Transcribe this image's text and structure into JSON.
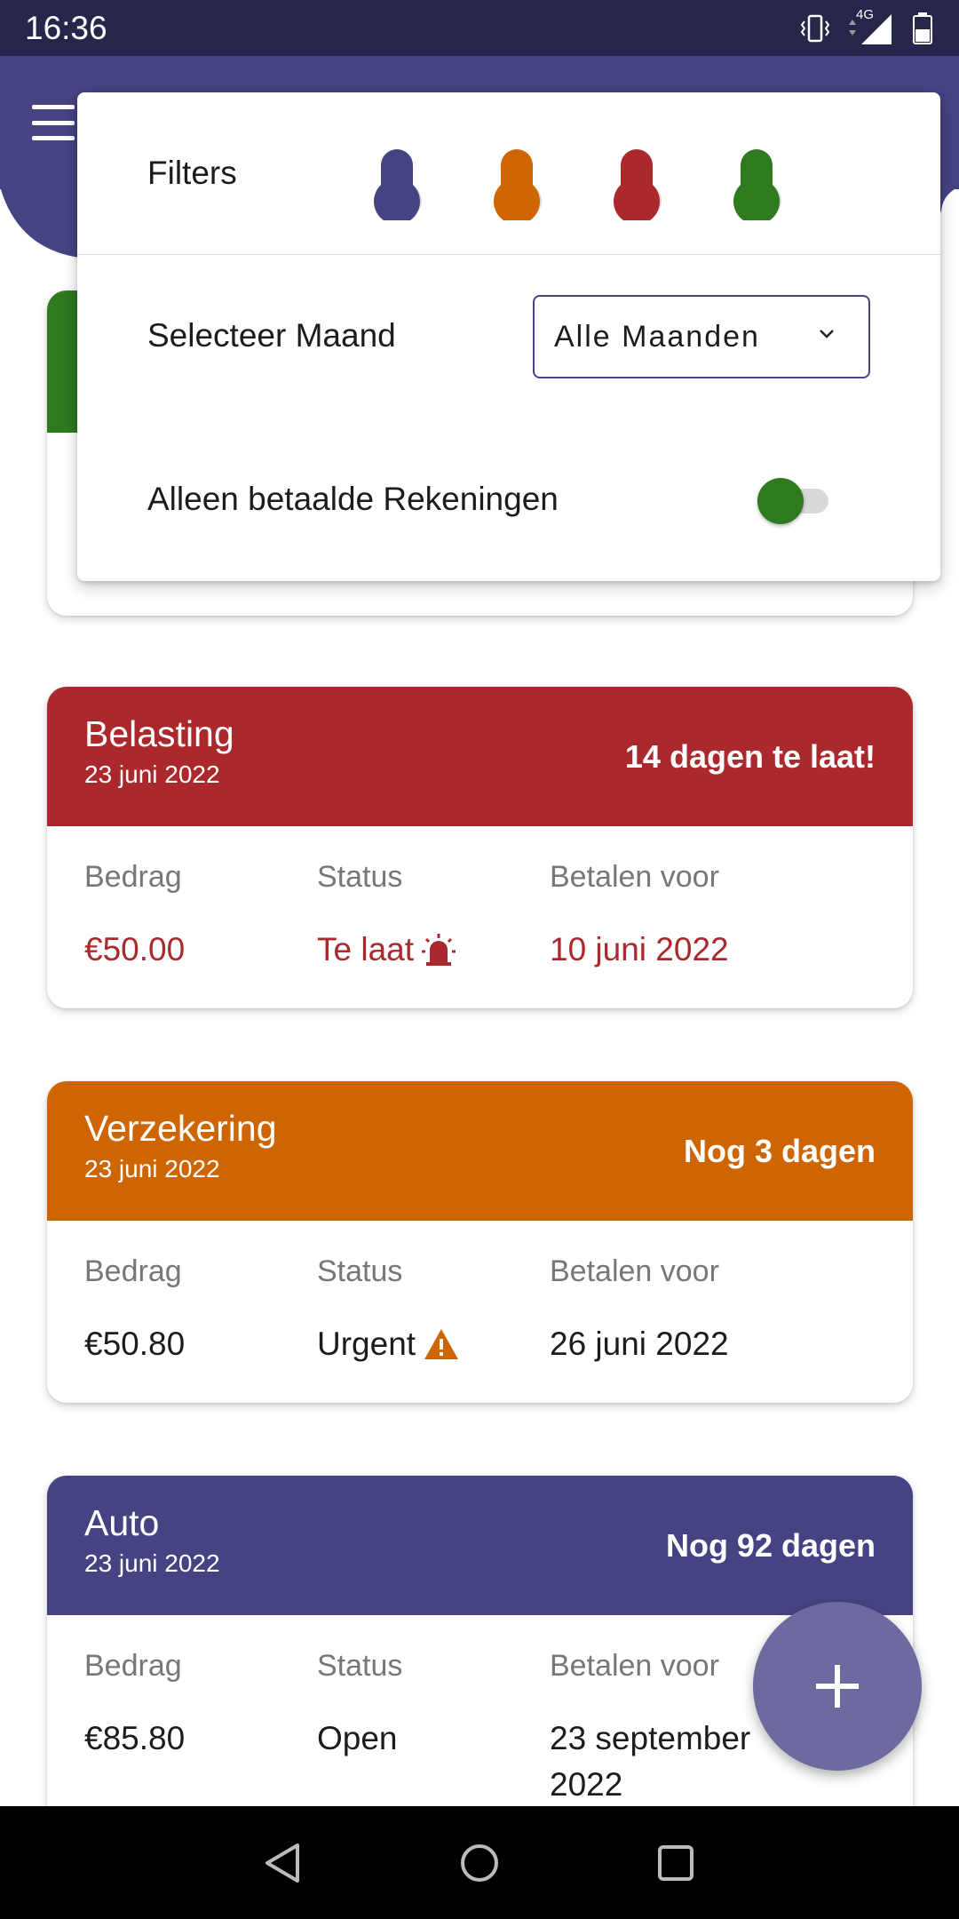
{
  "status_bar": {
    "time": "16:36",
    "network": "4G",
    "icons": [
      "vibrate-icon",
      "signal-icon",
      "battery-icon"
    ]
  },
  "header": {
    "menu_icon": "menu-icon",
    "color": "#454382"
  },
  "filter_popup": {
    "filters_label": "Filters",
    "filter_colors": [
      "#454382",
      "#cf6500",
      "#ab282c",
      "#2d7a1f"
    ],
    "month_label": "Selecteer Maand",
    "month_select_value": "Alle Maanden",
    "paid_only_label": "Alleen betaalde Rekeningen",
    "paid_only_toggle_color": "#2d7a1f"
  },
  "bills": [
    {
      "title": "Belasting",
      "date": "23 juni 2022",
      "due_text": "14 dagen te laat!",
      "amount_label": "Bedrag",
      "amount": "€50.00",
      "status_label": "Status",
      "status": "Te laat",
      "status_icon": "siren-icon",
      "pay_before_label": "Betalen voor",
      "pay_before": "10 juni 2022",
      "color": "#ab282c"
    },
    {
      "title": "Verzekering",
      "date": "23 juni 2022",
      "due_text": "Nog 3 dagen",
      "amount_label": "Bedrag",
      "amount": "€50.80",
      "status_label": "Status",
      "status": "Urgent",
      "status_icon": "warning-icon",
      "pay_before_label": "Betalen voor",
      "pay_before": "26 juni 2022",
      "color": "#cf6500"
    },
    {
      "title": "Auto",
      "date": "23 juni 2022",
      "due_text": "Nog 92 dagen",
      "amount_label": "Bedrag",
      "amount": "€85.80",
      "status_label": "Status",
      "status": "Open",
      "pay_before_label": "Betalen voor",
      "pay_before": "23 september 2022",
      "color": "#454382"
    }
  ],
  "fab": {
    "icon": "plus-icon"
  }
}
